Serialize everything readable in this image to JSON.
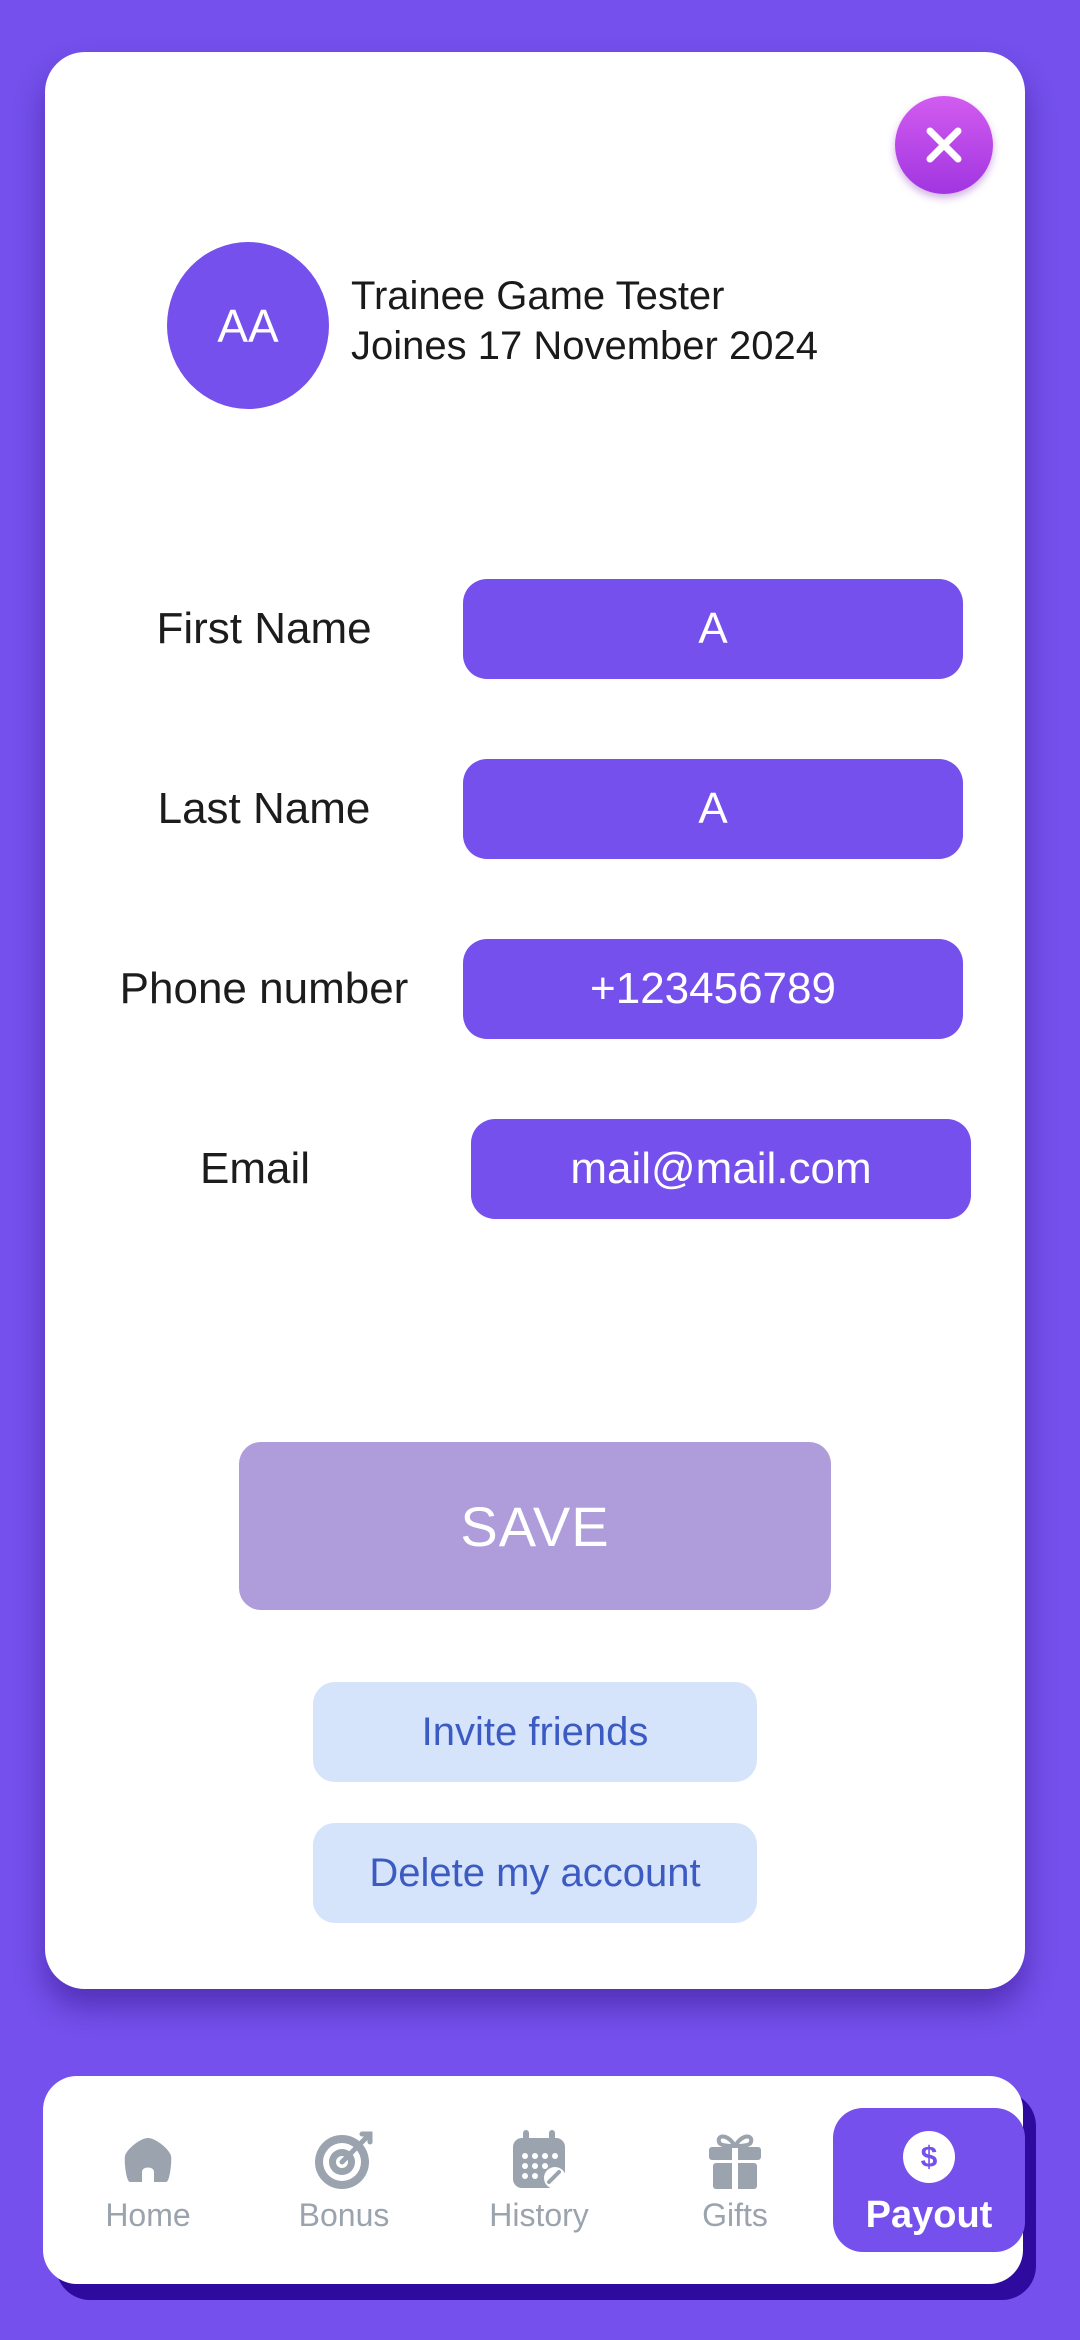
{
  "profile": {
    "initials": "AA",
    "title": "Trainee Game Tester",
    "joined": "Joines 17 November 2024"
  },
  "fields": {
    "first_name": {
      "label": "First Name",
      "value": "A"
    },
    "last_name": {
      "label": "Last Name",
      "value": "A"
    },
    "phone": {
      "label": "Phone number",
      "value": "+123456789"
    },
    "email": {
      "label": "Email",
      "value": "mail@mail.com"
    }
  },
  "actions": {
    "save": "SAVE",
    "invite": "Invite friends",
    "delete": "Delete my account"
  },
  "nav": {
    "items": [
      {
        "label": "Home",
        "icon": "home-icon"
      },
      {
        "label": "Bonus",
        "icon": "target-icon"
      },
      {
        "label": "History",
        "icon": "calendar-icon"
      },
      {
        "label": "Gifts",
        "icon": "gift-icon"
      },
      {
        "label": "Payout",
        "icon": "dollar-icon",
        "active": true
      }
    ]
  },
  "colors": {
    "background": "#7550EC",
    "accent": "#7550EC",
    "save_disabled": "#AE9CDB",
    "secondary_button": "#D6E4FB",
    "close_button": "#B846E8"
  }
}
